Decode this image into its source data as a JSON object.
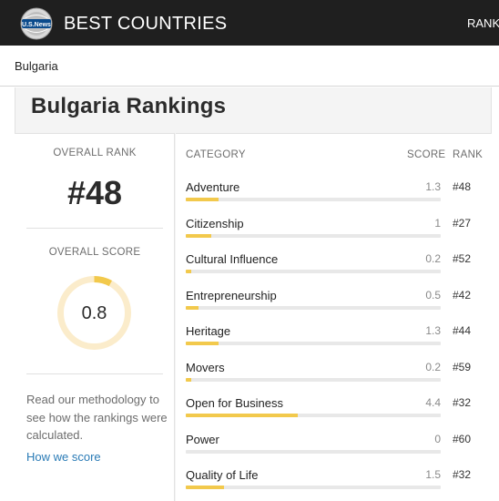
{
  "header": {
    "logo_text": "U.S.News",
    "brand": "BEST COUNTRIES",
    "nav_right": "RANK"
  },
  "breadcrumb": {
    "label": "Bulgaria"
  },
  "panel": {
    "title": "Bulgaria Rankings"
  },
  "overall": {
    "rank_label": "OVERALL RANK",
    "rank_value": "#48",
    "score_label": "OVERALL SCORE",
    "score_value": "0.8",
    "score_fraction": 0.08
  },
  "methodology": {
    "text": "Read our methodology to see how the rankings were calculated.",
    "link": "How we score"
  },
  "table": {
    "col_category": "CATEGORY",
    "col_score": "SCORE",
    "col_rank": "RANK",
    "max_score": 10,
    "rows": [
      {
        "name": "Adventure",
        "score": "1.3",
        "rank": "#48",
        "value": 1.3
      },
      {
        "name": "Citizenship",
        "score": "1",
        "rank": "#27",
        "value": 1.0
      },
      {
        "name": "Cultural Influence",
        "score": "0.2",
        "rank": "#52",
        "value": 0.2
      },
      {
        "name": "Entrepreneurship",
        "score": "0.5",
        "rank": "#42",
        "value": 0.5
      },
      {
        "name": "Heritage",
        "score": "1.3",
        "rank": "#44",
        "value": 1.3
      },
      {
        "name": "Movers",
        "score": "0.2",
        "rank": "#59",
        "value": 0.2
      },
      {
        "name": "Open for Business",
        "score": "4.4",
        "rank": "#32",
        "value": 4.4
      },
      {
        "name": "Power",
        "score": "0",
        "rank": "#60",
        "value": 0
      },
      {
        "name": "Quality of Life",
        "score": "1.5",
        "rank": "#32",
        "value": 1.5
      }
    ]
  },
  "colors": {
    "topbar": "#1f1f1f",
    "accent_yellow": "#f2c94c",
    "ring_track": "#fbeccb",
    "link": "#2a7bb6"
  }
}
